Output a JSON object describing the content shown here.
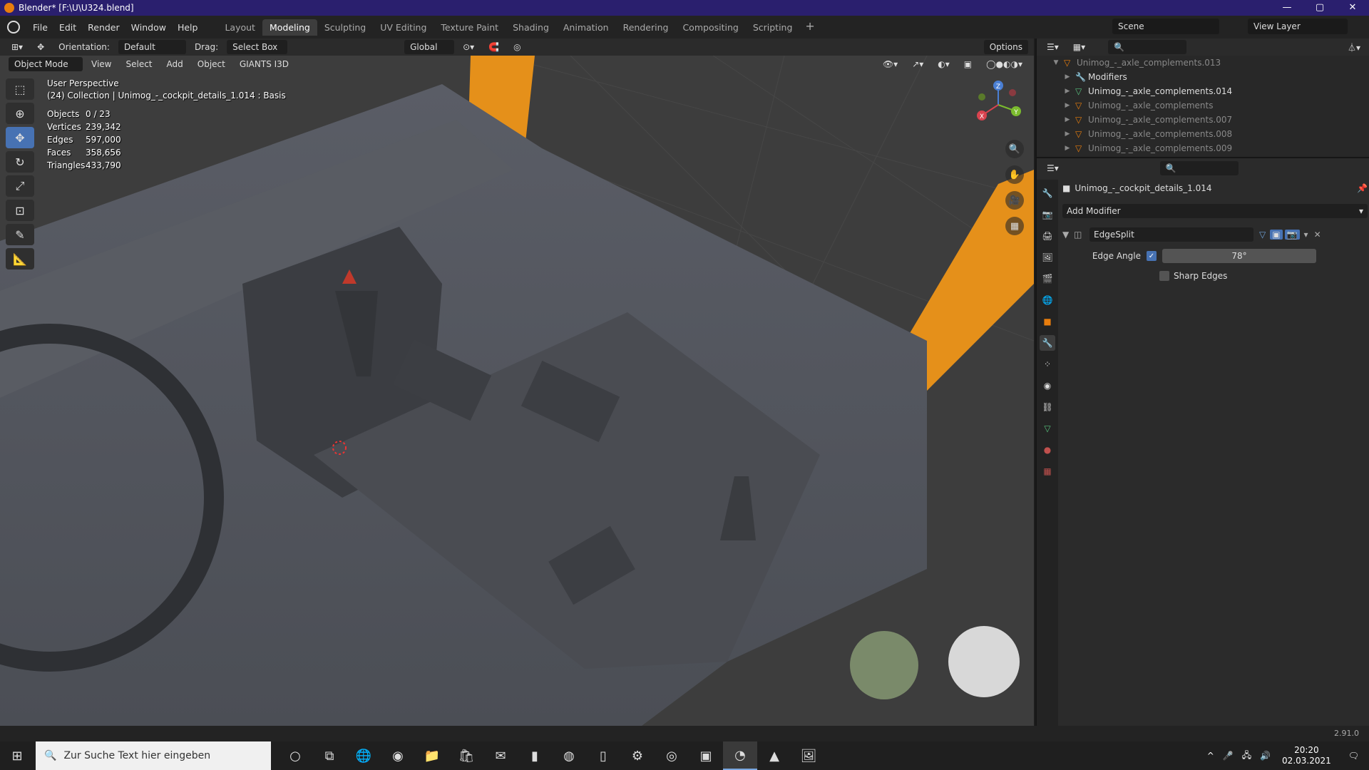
{
  "window": {
    "title": "Blender* [F:\\U\\U324.blend]",
    "controls": [
      "—",
      "▢",
      "✕"
    ]
  },
  "menu": [
    "File",
    "Edit",
    "Render",
    "Window",
    "Help"
  ],
  "workspaces": [
    {
      "label": "Layout"
    },
    {
      "label": "Modeling",
      "active": true
    },
    {
      "label": "Sculpting"
    },
    {
      "label": "UV Editing"
    },
    {
      "label": "Texture Paint"
    },
    {
      "label": "Shading"
    },
    {
      "label": "Animation"
    },
    {
      "label": "Rendering"
    },
    {
      "label": "Compositing"
    },
    {
      "label": "Scripting"
    }
  ],
  "scene": {
    "name": "Scene",
    "view_layer": "View Layer"
  },
  "toolbar": {
    "orientation_label": "Orientation:",
    "orientation_value": "Default",
    "drag_label": "Drag:",
    "drag_value": "Select Box",
    "transform_orientation": "Global",
    "options": "Options"
  },
  "header2": {
    "mode": "Object Mode",
    "items": [
      "View",
      "Select",
      "Add",
      "Object",
      "GIANTS I3D"
    ]
  },
  "viewport": {
    "perspective": "User Perspective",
    "collection": "(24) Collection | Unimog_-_cockpit_details_1.014 : Basis",
    "stats": [
      {
        "k": "Objects",
        "v": "0 / 23"
      },
      {
        "k": "Vertices",
        "v": "239,342"
      },
      {
        "k": "Edges",
        "v": "597,000"
      },
      {
        "k": "Faces",
        "v": "358,656"
      },
      {
        "k": "Triangles",
        "v": "433,790"
      }
    ],
    "gizmo": {
      "x": "X",
      "y": "Y",
      "z": "Z"
    }
  },
  "outliner": {
    "rows": [
      {
        "label": "Unimog_-_axle_complements.013",
        "dim": true,
        "icon": "mesh"
      },
      {
        "label": "Modifiers",
        "icon": "wrench"
      },
      {
        "label": "Unimog_-_axle_complements.014",
        "icon": "mesh-green"
      },
      {
        "label": "Unimog_-_axle_complements",
        "dim": true,
        "icon": "mesh"
      },
      {
        "label": "Unimog_-_axle_complements.007",
        "dim": true,
        "icon": "mesh"
      },
      {
        "label": "Unimog_-_axle_complements.008",
        "dim": true,
        "icon": "mesh"
      },
      {
        "label": "Unimog_-_axle_complements.009",
        "dim": true,
        "icon": "mesh"
      }
    ]
  },
  "properties": {
    "object_name": "Unimog_-_cockpit_details_1.014",
    "add_modifier": "Add Modifier",
    "modifier": {
      "name": "EdgeSplit",
      "edge_angle_label": "Edge Angle",
      "edge_angle_value": "78°",
      "edge_angle_checked": true,
      "sharp_edges_label": "Sharp Edges",
      "sharp_edges_checked": false
    }
  },
  "status": {
    "version": "2.91.0"
  },
  "taskbar": {
    "search_placeholder": "Zur Suche Text hier eingeben",
    "time": "20:20",
    "date": "02.03.2021"
  },
  "colors": {
    "accent": "#4772b3",
    "orange": "#e87d0d",
    "titlebar": "#2a1f6e"
  }
}
